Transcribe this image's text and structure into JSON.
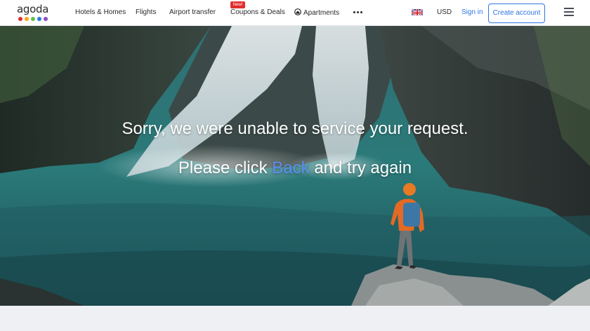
{
  "header": {
    "logo_text": "agoda",
    "logo_colors": [
      "#e12d2d",
      "#f6a91a",
      "#61c153",
      "#2d76e1",
      "#8a4ec4"
    ],
    "nav": [
      {
        "label": "Hotels & Homes"
      },
      {
        "label": "Flights"
      },
      {
        "label": "Airport transfer"
      },
      {
        "label": "Coupons & Deals",
        "badge": "New!"
      },
      {
        "label": "Apartments",
        "icon": "apartment-icon"
      }
    ],
    "more_icon": "more-dots-icon",
    "language_icon": "uk-flag-icon",
    "currency": "USD",
    "sign_in": "Sign in",
    "create_account": "Create account",
    "menu_icon": "hamburger-menu-icon"
  },
  "hero": {
    "message_line1": "Sorry, we were unable to service your request.",
    "message_prefix": "Please click ",
    "back_link": "Back",
    "message_suffix": " and try again"
  },
  "colors": {
    "accent": "#2d76e1",
    "badge": "#e12d2d",
    "back_link": "#5a8ff0"
  }
}
